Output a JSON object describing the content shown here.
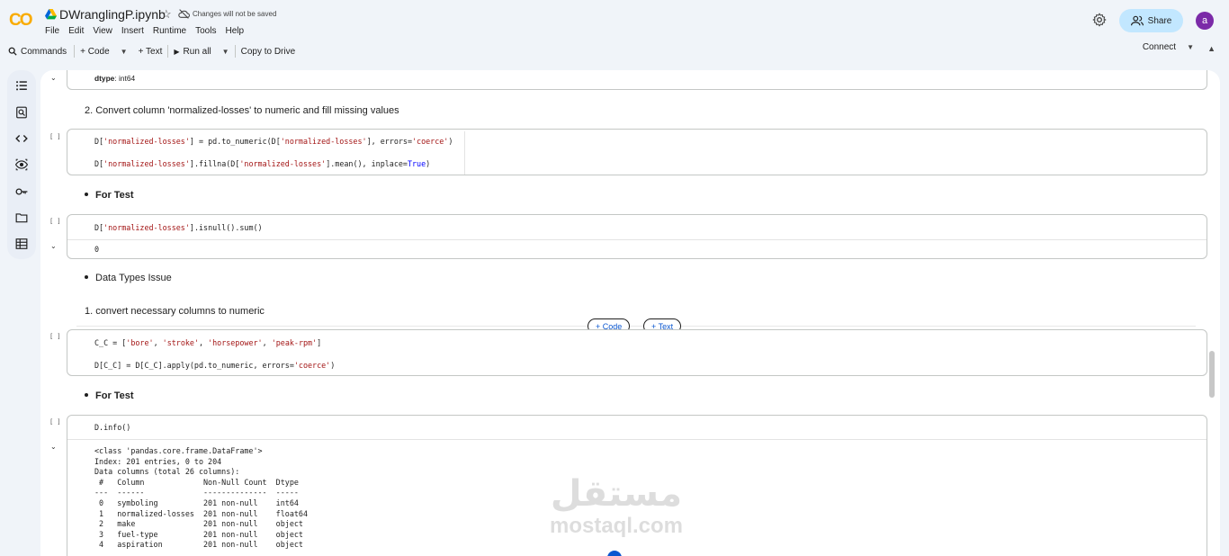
{
  "header": {
    "logo": "CO",
    "file_name": "DWranglingP.ipynb",
    "save_status": "Changes will not be saved",
    "menu": [
      "File",
      "Edit",
      "View",
      "Insert",
      "Runtime",
      "Tools",
      "Help"
    ],
    "share_label": "Share",
    "avatar_letter": "a"
  },
  "toolbar": {
    "commands": "Commands",
    "code": "+ Code",
    "text": "+ Text",
    "run_all": "Run all",
    "copy_to_drive": "Copy to Drive",
    "connect": "Connect"
  },
  "rail_icons": [
    "table-of-contents-icon",
    "search-code-icon",
    "code-snippets-icon",
    "variables-icon",
    "secrets-key-icon",
    "files-folder-icon",
    "data-table-icon"
  ],
  "cells": {
    "top_output": {
      "label": "dtype",
      "value": ": int64"
    },
    "md_convert": "2. Convert column 'normalized-losses' to numeric and fill missing values",
    "md_for_test_1": "For Test",
    "test_output": "0",
    "md_dtypes": "Data Types Issue",
    "md_convert_cols": "1. convert necessary columns to numeric",
    "md_for_test_2": "For Test",
    "run_indicator": "[ ]",
    "info_code": "D.info()",
    "info_output": "<class 'pandas.core.frame.DataFrame'>\nIndex: 201 entries, 0 to 204\nData columns (total 26 columns):\n #   Column             Non-Null Count  Dtype  \n---  ------             --------------  -----  \n 0   symboling          201 non-null    int64  \n 1   normalized-losses  201 non-null    float64\n 2   make               201 non-null    object \n 3   fuel-type          201 non-null    object \n 4   aspiration         201 non-null    object "
  },
  "add_buttons": {
    "code": "+ Code",
    "text": "+ Text"
  },
  "watermark": {
    "arabic": "مستقل",
    "latin": "mostaql.com"
  }
}
